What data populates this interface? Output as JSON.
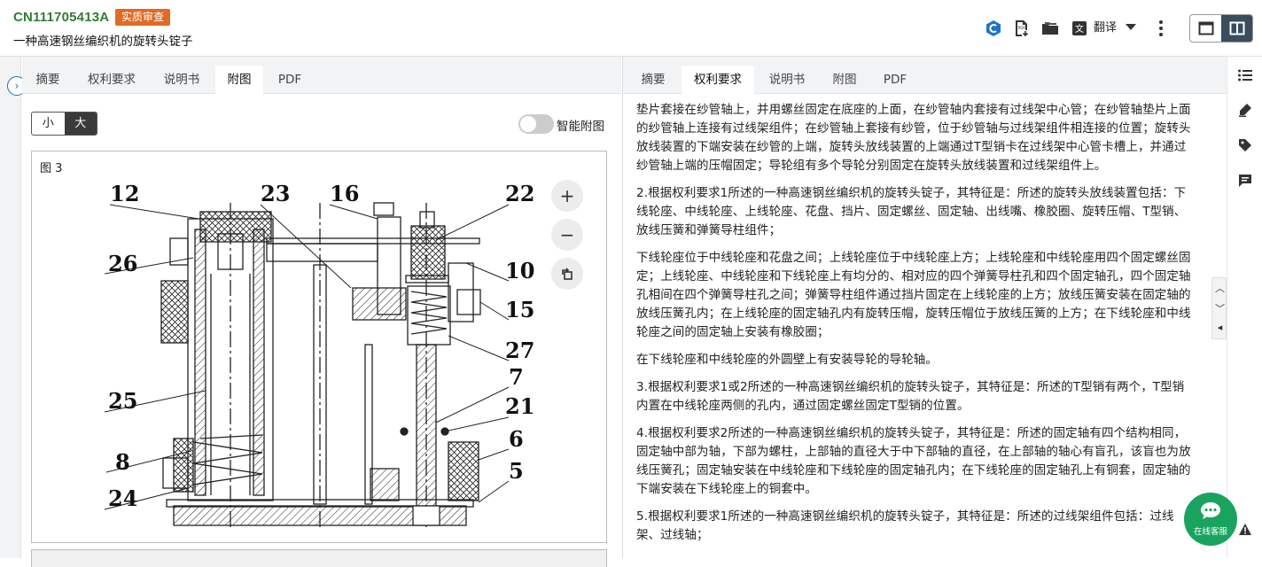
{
  "header": {
    "patent_number": "CN111705413A",
    "status_badge": "实质审查",
    "title": "一种高速钢丝编织机的旋转头锭子",
    "translate_label": "翻译"
  },
  "left_panel": {
    "tabs": [
      "摘要",
      "权利要求",
      "说明书",
      "附图",
      "PDF"
    ],
    "active_tab": "附图",
    "size_toggle": {
      "small": "小",
      "large": "大",
      "active": "大"
    },
    "smart_figure_label": "智能附图",
    "figure": {
      "label": "图 3",
      "callouts": [
        "12",
        "23",
        "16",
        "22",
        "26",
        "10",
        "15",
        "27",
        "7",
        "25",
        "21",
        "6",
        "8",
        "5",
        "24"
      ]
    }
  },
  "right_panel": {
    "tabs": [
      "摘要",
      "权利要求",
      "说明书",
      "附图",
      "PDF"
    ],
    "active_tab": "权利要求",
    "paragraphs": [
      "垫片套接在纱管轴上，并用螺丝固定在底座的上面，在纱管轴内套接有过线架中心管；在纱管轴垫片上面的纱管轴上连接有过线架组件；在纱管轴上套接有纱管，位于纱管轴与过线架组件相连接的位置；旋转头放线装置的下端安装在纱管的上端，旋转头放线装置的上端通过T型销卡在过线架中心管卡槽上，并通过纱管轴上端的压帽固定；导轮组有多个导轮分别固定在旋转头放线装置和过线架组件上。",
      "2.根据权利要求1所述的一种高速钢丝编织机的旋转头锭子，其特征是：所述的旋转头放线装置包括：下线轮座、中线轮座、上线轮座、花盘、挡片、固定螺丝、固定轴、出线嘴、橡胶圈、旋转压帽、T型销、放线压簧和弹簧导柱组件；",
      "下线轮座位于中线轮座和花盘之间；上线轮座位于中线轮座上方；上线轮座和中线轮座用四个固定螺丝固定；上线轮座、中线轮座和下线轮座上有均分的、相对应的四个弹簧导柱孔和四个固定轴孔，四个固定轴孔相间在四个弹簧导柱孔之间；弹簧导柱组件通过挡片固定在上线轮座的上方；放线压簧安装在固定轴的放线压簧孔内；在上线轮座的固定轴孔内有旋转压帽，旋转压帽位于放线压簧的上方；在下线轮座和中线轮座之间的固定轴上安装有橡胶圈；",
      "在下线轮座和中线轮座的外圆壁上有安装导轮的导轮轴。",
      "3.根据权利要求1或2所述的一种高速钢丝编织机的旋转头锭子，其特征是：所述的T型销有两个，T型销内置在中线轮座两侧的孔内，通过固定螺丝固定T型销的位置。",
      "4.根据权利要求2所述的一种高速钢丝编织机的旋转头锭子，其特征是：所述的固定轴有四个结构相同，固定轴中部为轴，下部为螺柱，上部轴的直径大于中下部轴的直径，在上部轴的轴心有盲孔，该盲也为放线压簧孔；固定轴安装在中线轮座和下线轮座的固定轴孔内；在下线轮座的固定轴孔上有铜套，固定轴的下端安装在下线轮座上的铜套中。",
      "5.根据权利要求1所述的一种高速钢丝编织机的旋转头锭子，其特征是：所述的过线架组件包括：过线架、过线轴；"
    ]
  },
  "chat": {
    "label": "在线客服"
  },
  "colors": {
    "accent_green": "#2f7d32",
    "badge_orange": "#e06b25",
    "chat_green": "#1aa35f",
    "toggle_dark": "#3a4d5c"
  }
}
